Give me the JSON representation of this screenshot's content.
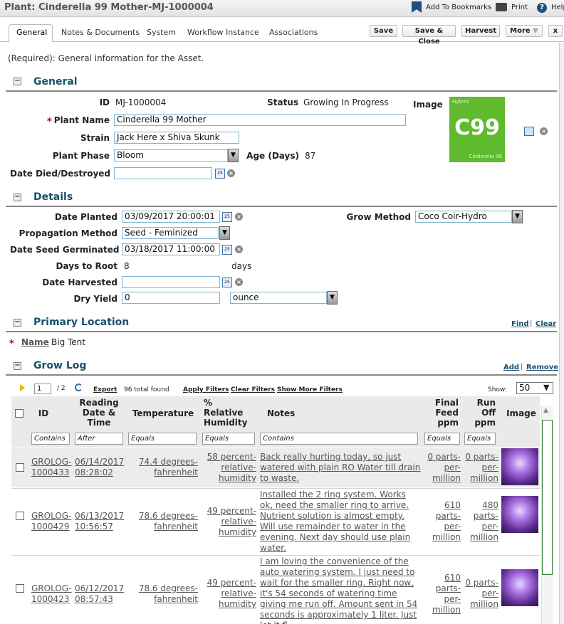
{
  "header": {
    "title": "Plant: Cinderella 99 Mother-MJ-1000004",
    "bookmarks_label": "Add To Bookmarks",
    "print_label": "Print",
    "help_label": "Help"
  },
  "tabs": [
    "General",
    "Notes & Documents",
    "System",
    "Workflow Instance",
    "Associations"
  ],
  "actions": {
    "save": "Save",
    "save_close": "Save & Close",
    "harvest": "Harvest",
    "more": "More",
    "close": "x"
  },
  "intro": "(Required): General information for the Asset.",
  "general": {
    "section_title": "General",
    "id_label": "ID",
    "id_value": "MJ-1000004",
    "status_label": "Status",
    "status_value": "Growing In Progress",
    "image_label": "Image",
    "plant_name_label": "Plant Name",
    "plant_name_value": "Cinderella 99 Mother",
    "strain_label": "Strain",
    "strain_value": "Jack Here x Shiva Skunk",
    "phase_label": "Plant Phase",
    "phase_value": "Bloom",
    "age_label": "Age (Days)",
    "age_value": "87",
    "died_label": "Date Died/Destroyed",
    "died_value": "",
    "tile": {
      "top": "Hybrid",
      "code": "C99",
      "bottom": "Cinderella 99",
      "color": "#5fba2e"
    }
  },
  "details": {
    "section_title": "Details",
    "planted_label": "Date Planted",
    "planted_value": "03/09/2017 20:00:01",
    "grow_method_label": "Grow Method",
    "grow_method_value": "Coco Coir-Hydro",
    "propagation_label": "Propagation Method",
    "propagation_value": "Seed - Feminized",
    "germinated_label": "Date Seed Germinated",
    "germinated_value": "03/18/2017 11:00:00",
    "days_root_label": "Days to Root",
    "days_root_value": "8",
    "days_unit": "days",
    "harvested_label": "Date Harvested",
    "harvested_value": "",
    "dry_yield_label": "Dry Yield",
    "dry_yield_value": "0",
    "dry_yield_unit": "ounce"
  },
  "location": {
    "section_title": "Primary Location",
    "find": "Find",
    "clear": "Clear",
    "name_label": "Name",
    "name_value": "Big Tent"
  },
  "growlog": {
    "section_title": "Grow Log",
    "add": "Add",
    "remove": "Remove",
    "page": "1",
    "page_total": "/ 2",
    "export": "Export",
    "total": "96 total found",
    "apply_filters": "Apply Filters",
    "clear_filters": "Clear Filters",
    "more_filters": "Show More Filters",
    "show_label": "Show:",
    "show_value": "50",
    "columns": {
      "id": "ID",
      "reading": "Reading Date & Time",
      "temperature": "Temperature",
      "humidity": "% Relative Humidity",
      "notes": "Notes",
      "feed": "Final Feed ppm",
      "runoff": "Run Off ppm",
      "image": "Image"
    },
    "filters": {
      "id": "Contains",
      "reading": "After",
      "temperature": "Equals",
      "humidity": "Equals",
      "notes": "Contains",
      "feed": "Equals",
      "runoff": "Equals"
    },
    "rows": [
      {
        "id": "GROLOG-1000433",
        "reading": "06/14/2017 08:28:02",
        "temperature": "74.4 degrees-fahrenheit",
        "humidity": "58 percent-relative-humidity",
        "notes": "Back really hurting today, so just watered with plain RO Water till drain to waste.",
        "feed": "0 parts-per-million",
        "runoff": "0 parts-per-million"
      },
      {
        "id": "GROLOG-1000429",
        "reading": "06/13/2017 10:56:57",
        "temperature": "78.6 degrees-fahrenheit",
        "humidity": "49 percent-relative-humidity",
        "notes": "Installed the 2 ring system. Works ok, need the smaller ring to arrive. Nutrient solution is almost empty. Will use remainder to water in the evening. Next day should use plain water.",
        "feed": "610 parts-per-million",
        "runoff": "480 parts-per-million"
      },
      {
        "id": "GROLOG-1000423",
        "reading": "06/12/2017 08:57:43",
        "temperature": "78.6 degrees-fahrenheit",
        "humidity": "49 percent-relative-humidity",
        "notes": "I am loving the convenience of the auto watering system. I just need to wait for the smaller ring. Right now, it's 54 seconds of watering time giving me run off. Amount sent in 54 seconds is approximately 1 liter. Just let it fl",
        "feed": "610 parts-per-million",
        "runoff": "0 parts-per-million"
      }
    ]
  }
}
